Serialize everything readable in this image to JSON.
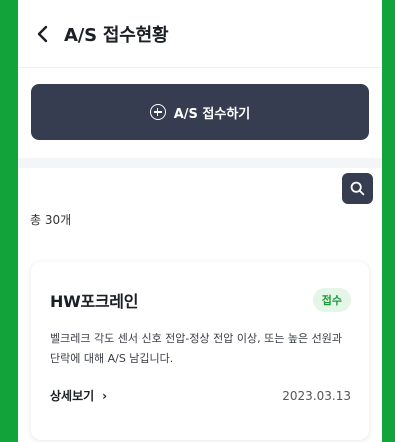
{
  "header": {
    "title": "A/S 접수현황"
  },
  "actions": {
    "add_label": "A/S 접수하기"
  },
  "list": {
    "total_label": "총 30개"
  },
  "items": [
    {
      "title": "HW포크레인",
      "status": "접수",
      "description": "벨크레크 각도 센서 신호 전압-정상 전압 이상, 또는 높은 선원과 단락에 대해 A/S 남깁니다.",
      "detail_label": "상세보기",
      "date": "2023.03.13"
    }
  ],
  "colors": {
    "background": "#12a43a",
    "accent_dark": "#373d51",
    "status_green": "#1f9a3b"
  },
  "icons": {
    "back": "chevron-left-icon",
    "add": "plus-circle-icon",
    "search": "search-icon",
    "detail": "chevron-right-icon"
  }
}
